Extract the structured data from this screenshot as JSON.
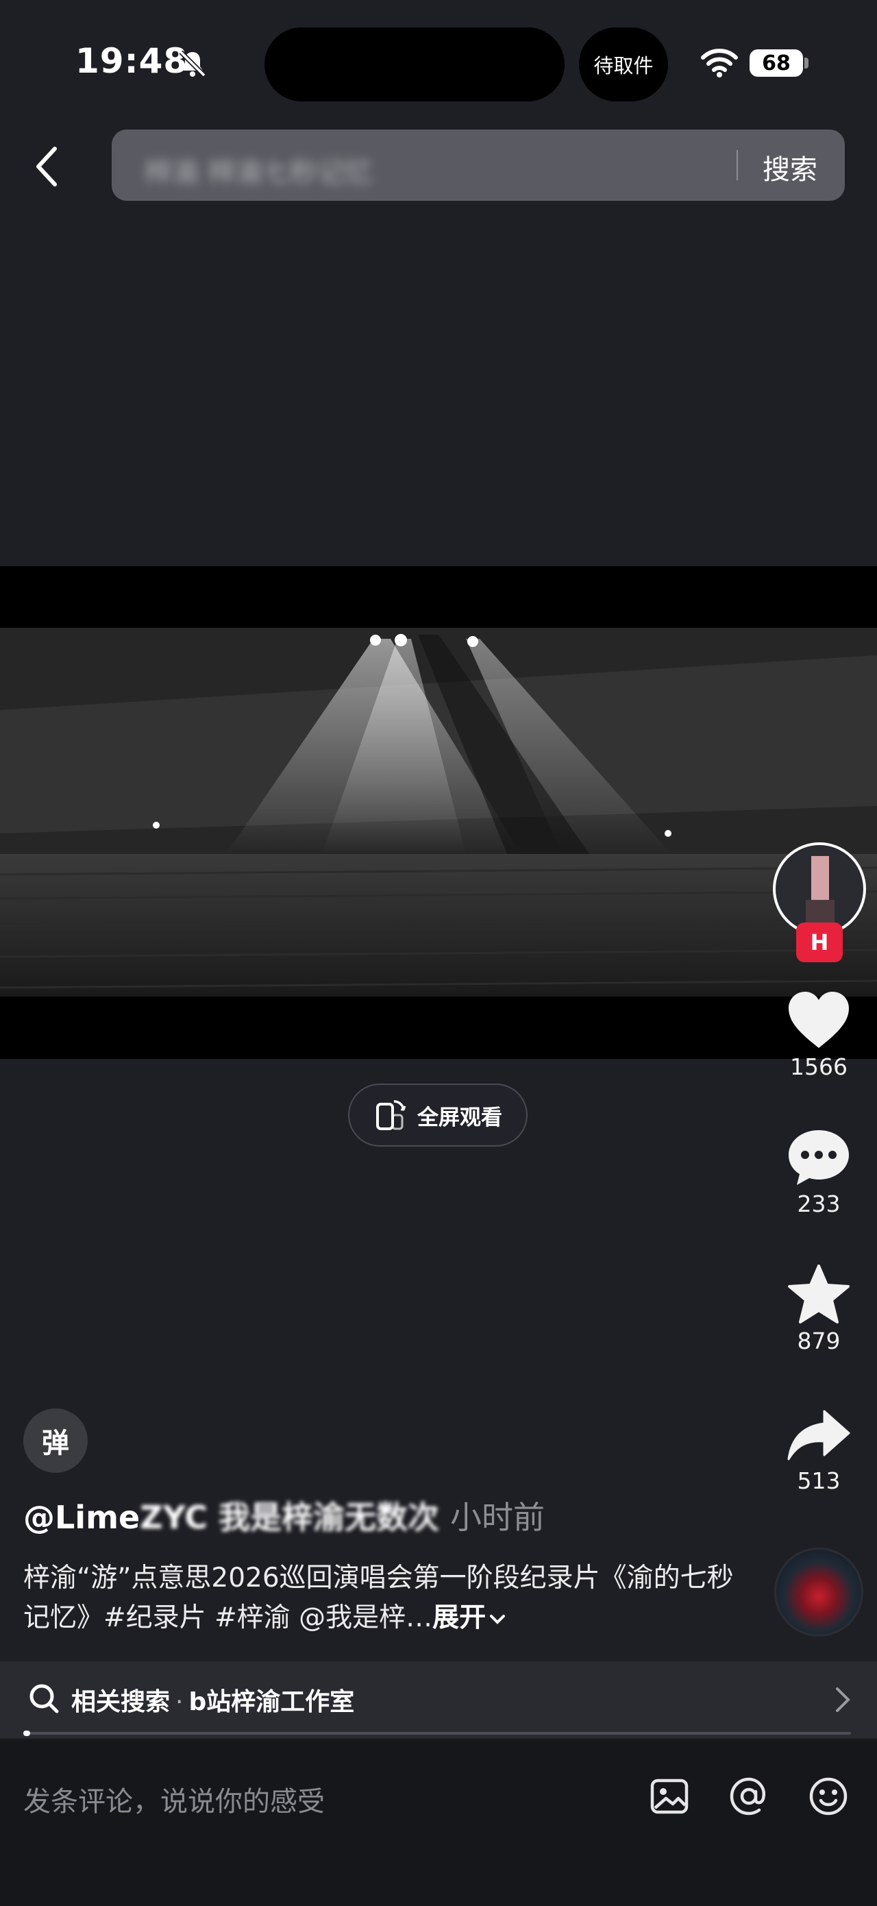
{
  "status_bar": {
    "time": "19:48",
    "pickup_label": "待取件",
    "battery": "68"
  },
  "header": {
    "search_query": "梓渝 梓渝七秒记忆",
    "search_button": "搜索"
  },
  "player": {
    "fullscreen_label": "全屏观看",
    "progress": 0.005
  },
  "actions": {
    "author_badge": "H",
    "likes": "1566",
    "comments": "233",
    "favorites": "879",
    "shares": "513"
  },
  "post": {
    "danmaku_label": "弹",
    "author_prefix": "@Lime",
    "author_blurred": "ZYC 我是梓渝无数次",
    "time_ago": "小时前",
    "caption": "梓渝“游”点意思2026巡回演唱会第一阶段纪录片《渝的七秒记忆》#纪录片 #梓渝 @我是梓…",
    "expand_label": "展开"
  },
  "related": {
    "label": "相关搜索",
    "dot": "·",
    "query": "b站梓渝工作室"
  },
  "comment_bar": {
    "placeholder": "发条评论，说说你的感受"
  },
  "icons": {
    "bell": "bell-slash-icon",
    "wifi": "wifi-icon",
    "back": "chevron-left-icon",
    "like": "heart-icon",
    "comment": "speech-bubble-icon",
    "favorite": "star-icon",
    "share": "share-arrow-icon",
    "image": "image-icon",
    "mention": "at-icon",
    "emoji": "smile-icon"
  },
  "colors": {
    "background": "#1e1f25",
    "search_box": "#5a5b62",
    "badge_red": "#e8223c",
    "muted_text": "#8d8e94"
  }
}
